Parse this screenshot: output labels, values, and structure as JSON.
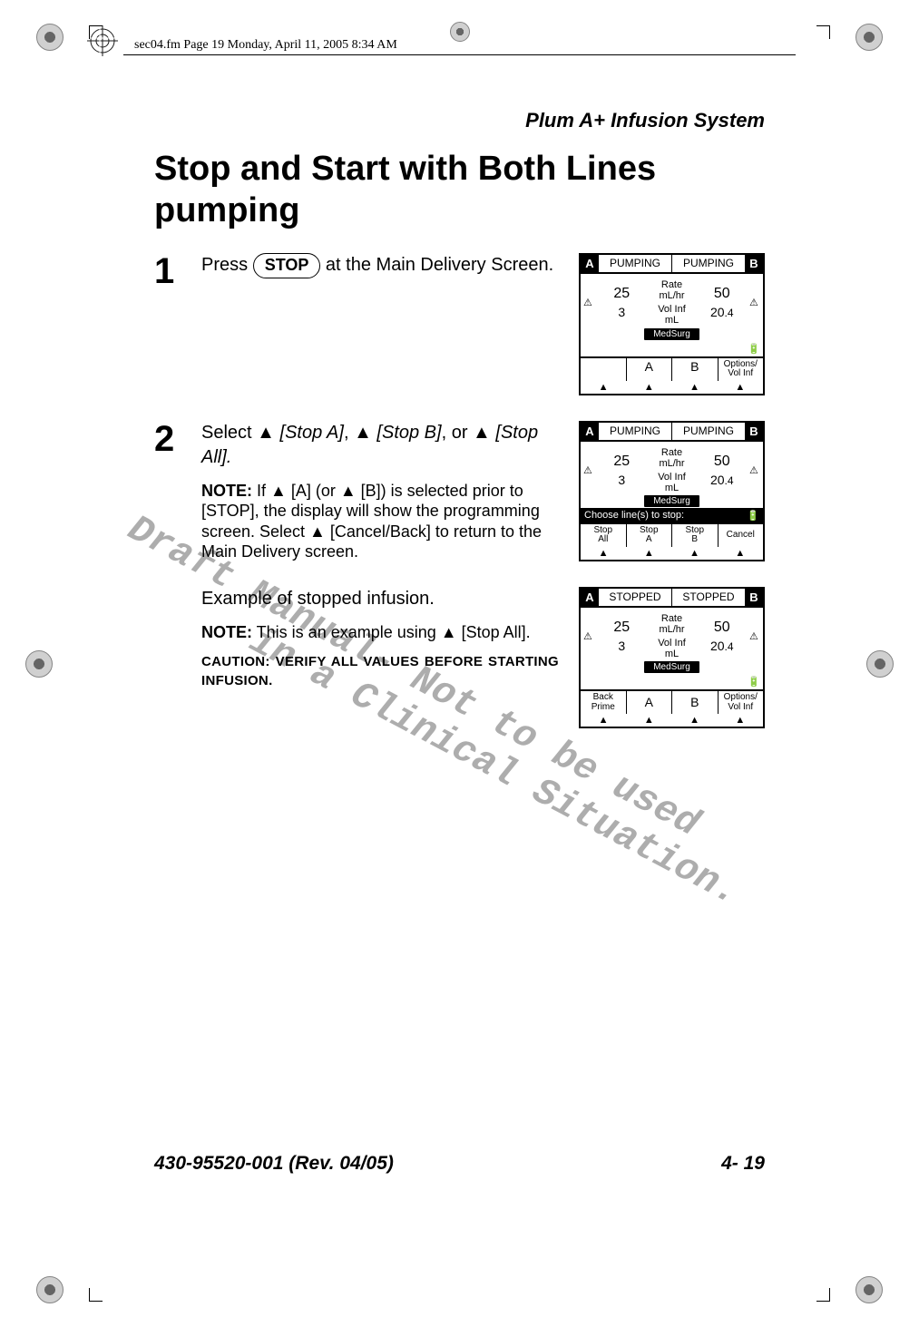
{
  "page_header": "sec04.fm  Page 19  Monday, April 11, 2005  8:34 AM",
  "running_head": "Plum A+ Infusion System",
  "title": "Stop and Start with Both Lines pumping",
  "watermark": "Draft Manual- Not to be used\n       in a Clinical Situation.",
  "steps": {
    "s1": {
      "num": "1",
      "text_a": "Press ",
      "stop": "STOP",
      "text_b": " at the Main Delivery Screen."
    },
    "s2": {
      "num": "2",
      "text_a": "Select ",
      "stop_a": "[Stop A]",
      "sep": ", ",
      "stop_b": "[Stop B]",
      "sep2": ", or ",
      "stop_all": "[Stop All].",
      "note_label": "NOTE:",
      "note": " If ▲ [A] (or ▲ [B]) is selected prior to [STOP], the display will show the programming screen. Select ▲ [Cancel/Back] to return to the Main Delivery screen."
    },
    "s3": {
      "example": "Example of stopped infusion.",
      "note_label": "NOTE:",
      "note": " This is an example using ▲ [Stop All].",
      "caution_label": "CAUTION:",
      "caution": " VERIFY ALL VALUES BEFORE STARTING INFUSION."
    }
  },
  "device1": {
    "A": "A",
    "B": "B",
    "statusA": "PUMPING",
    "statusB": "PUMPING",
    "rateA": "25",
    "rateB": "50",
    "rateLbl": "Rate",
    "rateUnit": "mL/hr",
    "volA": "3",
    "volB": "20",
    "volBfrac": ".4",
    "volLbl": "Vol Inf",
    "volUnit": "mL",
    "cca": "MedSurg",
    "soft1": "",
    "soft2": "A",
    "soft3": "B",
    "soft4a": "Options/",
    "soft4b": "Vol Inf"
  },
  "device2": {
    "A": "A",
    "B": "B",
    "statusA": "PUMPING",
    "statusB": "PUMPING",
    "rateA": "25",
    "rateB": "50",
    "rateLbl": "Rate",
    "rateUnit": "mL/hr",
    "volA": "3",
    "volB": "20",
    "volBfrac": ".4",
    "volLbl": "Vol Inf",
    "volUnit": "mL",
    "cca": "MedSurg",
    "prompt": "Choose line(s) to stop:",
    "soft1a": "Stop",
    "soft1b": "All",
    "soft2a": "Stop",
    "soft2b": "A",
    "soft3a": "Stop",
    "soft3b": "B",
    "soft4": "Cancel"
  },
  "device3": {
    "A": "A",
    "B": "B",
    "statusA": "STOPPED",
    "statusB": "STOPPED",
    "rateA": "25",
    "rateB": "50",
    "rateLbl": "Rate",
    "rateUnit": "mL/hr",
    "volA": "3",
    "volB": "20",
    "volBfrac": ".4",
    "volLbl": "Vol Inf",
    "volUnit": "mL",
    "cca": "MedSurg",
    "soft1a": "Back",
    "soft1b": "Prime",
    "soft2": "A",
    "soft3": "B",
    "soft4a": "Options/",
    "soft4b": "Vol Inf"
  },
  "footer": {
    "left": "430-95520-001 (Rev. 04/05)",
    "right": "4- 19"
  }
}
